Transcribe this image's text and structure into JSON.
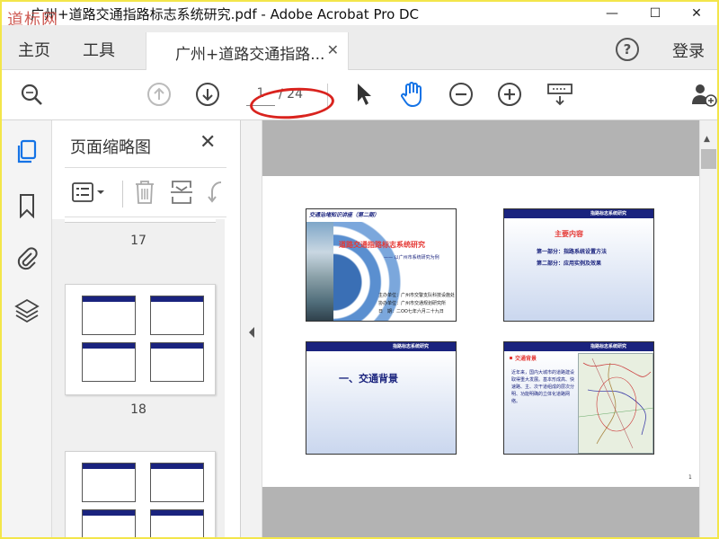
{
  "window": {
    "title": "广州+道路交通指路标志系统研究.pdf - Adobe Acrobat Pro DC",
    "watermark": "道标网",
    "controls": [
      "—",
      "☐",
      "✕"
    ]
  },
  "tabbar": {
    "home": "主页",
    "tools": "工具",
    "doc_tab": "广州+道路交通指路...",
    "login": "登录",
    "help": "?"
  },
  "toolbar": {
    "current_page": "1",
    "total_pages": "/ 24"
  },
  "panel": {
    "title": "页面缩略图",
    "page_numbers": [
      "17",
      "18"
    ]
  },
  "page": {
    "page_number": "1",
    "slides": {
      "s1": {
        "header": "交通治堵知识讲座（第二期）",
        "title": "道路交通指路标志系统研究",
        "subtitle": "—— 以广州市系统研究为例",
        "line1": "主办单位：广州市交警支队科技设施处",
        "line2": "协办单位：广州市交通规划研究所",
        "line3": "日　期：二OO七年六月二十九日"
      },
      "s2": {
        "header": "指路标志系统研究",
        "title": "主要内容",
        "item1": "第一部分：指路系统设置方法",
        "item2": "第二部分：应用实例及效果"
      },
      "s3": {
        "header": "指路标志系统研究",
        "title": "一、交通背景"
      },
      "s4": {
        "header": "指路标志系统研究",
        "bullet_title": "交通背景",
        "body": "近年来，国内大城市的道路建设取得重大发展。基本形成高、快速路、主、次干道组成的层次分明、功能明确的立体化道路网络。"
      }
    }
  },
  "colors": {
    "accent_red": "#d9231e",
    "acrobat_blue": "#1473e6",
    "slide_navy": "#1a237e",
    "slide_red": "#e53935"
  },
  "icons": [
    "zoom-icon",
    "page-up-icon",
    "page-down-icon",
    "select-cursor-icon",
    "hand-tool-icon",
    "zoom-out-icon",
    "zoom-in-icon",
    "keyboard-icon",
    "add-user-icon",
    "thumbnails-icon",
    "bookmark-icon",
    "attachment-icon",
    "layers-icon",
    "thumb-options-icon",
    "delete-icon",
    "extract-icon",
    "undo-icon"
  ]
}
